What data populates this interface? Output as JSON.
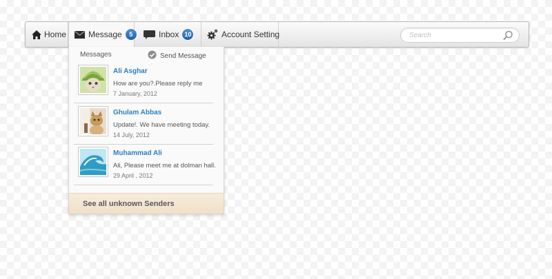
{
  "nav": {
    "home_label": "Home",
    "message_label": "Message",
    "message_count": "5",
    "inbox_label": "Inbox",
    "inbox_count": "10",
    "account_label": "Account Setting",
    "search_placeholder": "Search"
  },
  "dropdown": {
    "title": "Messages",
    "send_label": "Send Message",
    "messages": [
      {
        "name": "Ali Asghar",
        "text": "How are you?.Please reply me",
        "date": "7 January, 2012"
      },
      {
        "name": "Ghulam Abbas",
        "text": "Update!. We have meeting today.",
        "date": "14 July, 2012"
      },
      {
        "name": "Muhammad Ali",
        "text": "Ali, Please meet me at dolman hall.",
        "date": "29 April , 2012"
      }
    ],
    "footer_label": "See all unknown Senders"
  },
  "colors": {
    "badge": "#2f6fb6",
    "name_link": "#2a7fc4",
    "footer_bg": "#f3e4cf"
  }
}
